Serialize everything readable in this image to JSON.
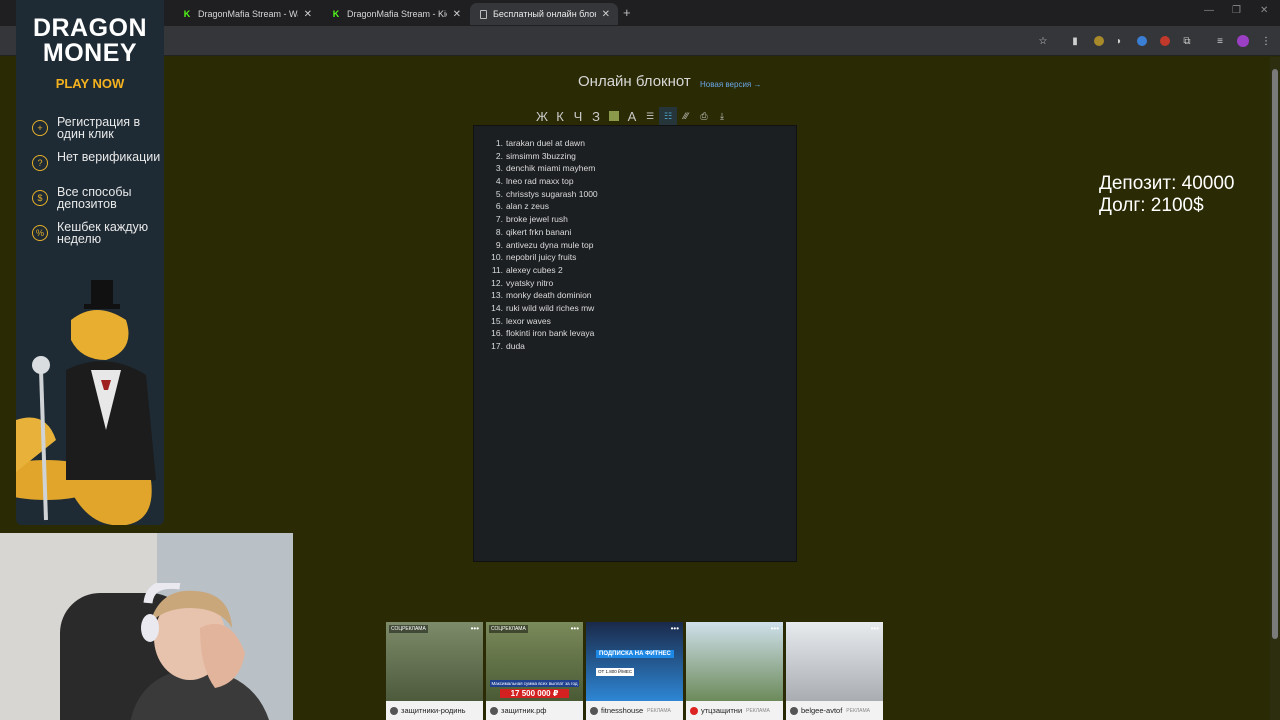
{
  "browser": {
    "tabs": [
      {
        "title": "DragonMafia Stream - Watch L",
        "icon": "kick-icon"
      },
      {
        "title": "DragonMafia Stream - Kick Da",
        "icon": "kick-icon"
      },
      {
        "title": "Бесплатный онлайн блокнот д",
        "icon": "doc-icon",
        "active": true
      }
    ],
    "new_tab": "+",
    "window_controls": [
      "—",
      "❐",
      "✕"
    ]
  },
  "page": {
    "title": "Онлайн блокнот",
    "new_version_link": "Новая версия →",
    "editor_toolbar": [
      "Ж",
      "К",
      "Ч",
      "З",
      "",
      "A",
      "☰",
      "☷",
      "⁄⁄⁄",
      "⎙",
      "⤓"
    ],
    "list": [
      "tarakan duel at dawn",
      "simsimm 3buzzing",
      "denchik miami mayhem",
      "lneo rad maxx top",
      "chrisstys sugarash 1000",
      "alan z zeus",
      "broke jewel rush",
      "qikert frkn banani",
      "antivezu dyna mule top",
      "nepobril juicy fruits",
      "alexey cubes 2",
      "vyatsky nitro",
      "monky death dominion",
      "ruki wild wild riches mw",
      "lexor waves",
      "flokinti iron bank levaya",
      "duda"
    ]
  },
  "overlay": {
    "deposit": "Депозит: 40000",
    "debt": "Долг: 2100$"
  },
  "ad_banner": {
    "brand_line1": "DRAGON",
    "brand_line2": "MONEY",
    "cta": "PLAY NOW",
    "features": [
      {
        "icon": "plus-icon",
        "text": "Регистрация в один клик"
      },
      {
        "icon": "question-icon",
        "text": "Нет верификации"
      },
      {
        "icon": "coin-icon",
        "text": "Все способы депозитов"
      },
      {
        "icon": "percent-icon",
        "text": "Кешбек каждую неделю"
      }
    ]
  },
  "ads_strip": [
    {
      "tag": "СОЦРЕКЛАМА",
      "caption": "защитники-родинь",
      "rk": "",
      "color": "#6c7a5a"
    },
    {
      "tag": "СОЦРЕКЛАМА",
      "caption": "защитник.рф",
      "rk": "",
      "color": "#5f6e45",
      "banner": "Максимальная сумма всех выплат за год",
      "banner2": "17 500 000 ₽"
    },
    {
      "tag": "",
      "caption": "fitnesshouse",
      "rk": "РЕКЛАМА",
      "color": "#2b6fbf",
      "banner": "ПОДПИСКА НА ФИТНЕС",
      "banner2": "ОТ 1.800 ₽/МЕС"
    },
    {
      "tag": "",
      "caption": "утцзащитни",
      "rk": "РЕКЛАМА",
      "color": "#8aa7b8"
    },
    {
      "tag": "",
      "caption": "belgee-avtof",
      "rk": "РЕКЛАМА",
      "color": "#c9ccd0"
    }
  ],
  "colors": {
    "page_bg": "#2a2a04",
    "editor_bg": "#1c1f22",
    "accent_gold": "#f5b21f",
    "link": "#6aa7e8"
  }
}
